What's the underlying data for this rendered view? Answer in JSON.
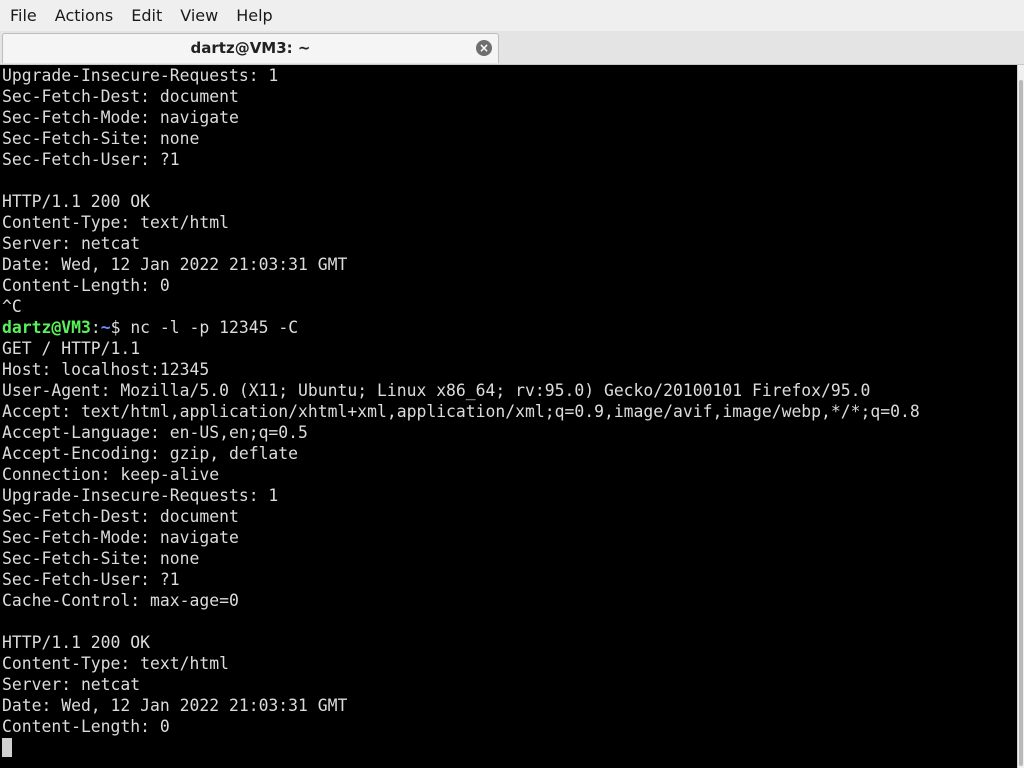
{
  "menubar": {
    "items": [
      "File",
      "Actions",
      "Edit",
      "View",
      "Help"
    ]
  },
  "tab": {
    "title": "dartz@VM3: ~",
    "close_icon": "×"
  },
  "terminal": {
    "lines_before_prompt": [
      "Upgrade-Insecure-Requests: 1",
      "Sec-Fetch-Dest: document",
      "Sec-Fetch-Mode: navigate",
      "Sec-Fetch-Site: none",
      "Sec-Fetch-User: ?1",
      "",
      "HTTP/1.1 200 OK",
      "Content-Type: text/html",
      "Server: netcat",
      "Date: Wed, 12 Jan 2022 21:03:31 GMT",
      "Content-Length: 0",
      "^C"
    ],
    "prompt": {
      "user_host": "dartz@VM3",
      "separator": ":",
      "path": "~",
      "symbol": "$ ",
      "command": "nc -l -p 12345 -C"
    },
    "lines_after_prompt": [
      "GET / HTTP/1.1",
      "Host: localhost:12345",
      "User-Agent: Mozilla/5.0 (X11; Ubuntu; Linux x86_64; rv:95.0) Gecko/20100101 Firefox/95.0",
      "Accept: text/html,application/xhtml+xml,application/xml;q=0.9,image/avif,image/webp,*/*;q=0.8",
      "Accept-Language: en-US,en;q=0.5",
      "Accept-Encoding: gzip, deflate",
      "Connection: keep-alive",
      "Upgrade-Insecure-Requests: 1",
      "Sec-Fetch-Dest: document",
      "Sec-Fetch-Mode: navigate",
      "Sec-Fetch-Site: none",
      "Sec-Fetch-User: ?1",
      "Cache-Control: max-age=0",
      "",
      "HTTP/1.1 200 OK",
      "Content-Type: text/html",
      "Server: netcat",
      "Date: Wed, 12 Jan 2022 21:03:31 GMT",
      "Content-Length: 0"
    ],
    "colors": {
      "background": "#000000",
      "text": "#dcdcdc",
      "prompt_user": "#5af25a",
      "prompt_path": "#6f8cff"
    }
  }
}
